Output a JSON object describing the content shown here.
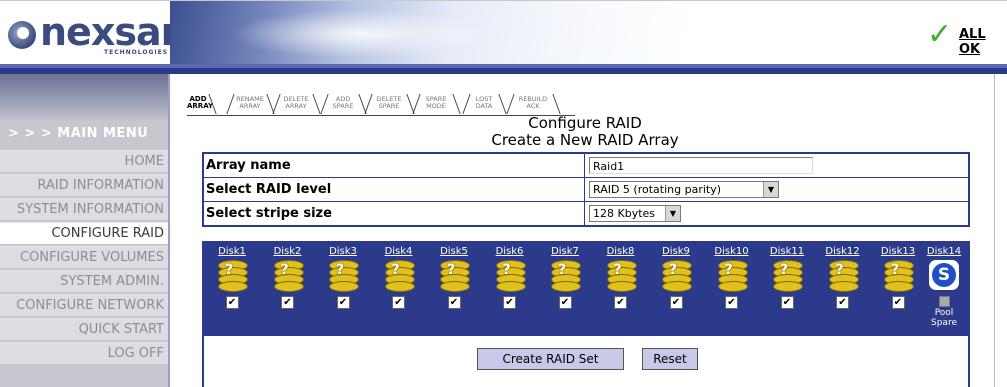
{
  "brand": {
    "name": "nexsan",
    "tagline": "TECHNOLOGIES"
  },
  "status": {
    "icon": "checkmark-icon",
    "text": "ALL OK"
  },
  "nav": {
    "heading": "> > > MAIN MENU",
    "items": [
      {
        "label": "HOME",
        "active": false
      },
      {
        "label": "RAID INFORMATION",
        "active": false
      },
      {
        "label": "SYSTEM INFORMATION",
        "active": false
      },
      {
        "label": "CONFIGURE RAID",
        "active": true
      },
      {
        "label": "CONFIGURE VOLUMES",
        "active": false
      },
      {
        "label": "SYSTEM ADMIN.",
        "active": false
      },
      {
        "label": "CONFIGURE NETWORK",
        "active": false
      },
      {
        "label": "QUICK START",
        "active": false
      },
      {
        "label": "LOG OFF",
        "active": false
      }
    ]
  },
  "tabs": [
    {
      "line1": "ADD",
      "line2": "ARRAY",
      "active": true
    },
    {
      "line1": "RENAME",
      "line2": "ARRAY",
      "active": false
    },
    {
      "line1": "DELETE",
      "line2": "ARRAY",
      "active": false
    },
    {
      "line1": "ADD",
      "line2": "SPARE",
      "active": false
    },
    {
      "line1": "DELETE",
      "line2": "SPARE",
      "active": false
    },
    {
      "line1": "SPARE",
      "line2": "MODE",
      "active": false
    },
    {
      "line1": "LOST",
      "line2": "DATA",
      "active": false
    },
    {
      "line1": "REBUILD",
      "line2": "ACK",
      "active": false
    }
  ],
  "page": {
    "title": "Configure RAID",
    "subtitle": "Create a New RAID Array"
  },
  "form": {
    "array_name_label": "Array name",
    "array_name_value": "Raid1",
    "raid_level_label": "Select RAID level",
    "raid_level_value": "RAID 5 (rotating parity)",
    "stripe_size_label": "Select stripe size",
    "stripe_size_value": "128 Kbytes"
  },
  "disks": [
    {
      "label": "Disk1",
      "checked": true
    },
    {
      "label": "Disk2",
      "checked": true
    },
    {
      "label": "Disk3",
      "checked": true
    },
    {
      "label": "Disk4",
      "checked": true
    },
    {
      "label": "Disk5",
      "checked": true
    },
    {
      "label": "Disk6",
      "checked": true
    },
    {
      "label": "Disk7",
      "checked": true
    },
    {
      "label": "Disk8",
      "checked": true
    },
    {
      "label": "Disk9",
      "checked": true
    },
    {
      "label": "Disk10",
      "checked": true
    },
    {
      "label": "Disk11",
      "checked": true
    },
    {
      "label": "Disk12",
      "checked": true
    },
    {
      "label": "Disk13",
      "checked": true
    }
  ],
  "spare_disk": {
    "label": "Disk14",
    "icon": "pool-spare-icon",
    "badge": "S",
    "line1": "Pool",
    "line2": "Spare"
  },
  "actions": {
    "create_label": "Create RAID Set",
    "reset_label": "Reset"
  },
  "colors": {
    "accent": "#2b3a8a",
    "disk_gold": "#e2c11e",
    "ok_green": "#39b031"
  }
}
